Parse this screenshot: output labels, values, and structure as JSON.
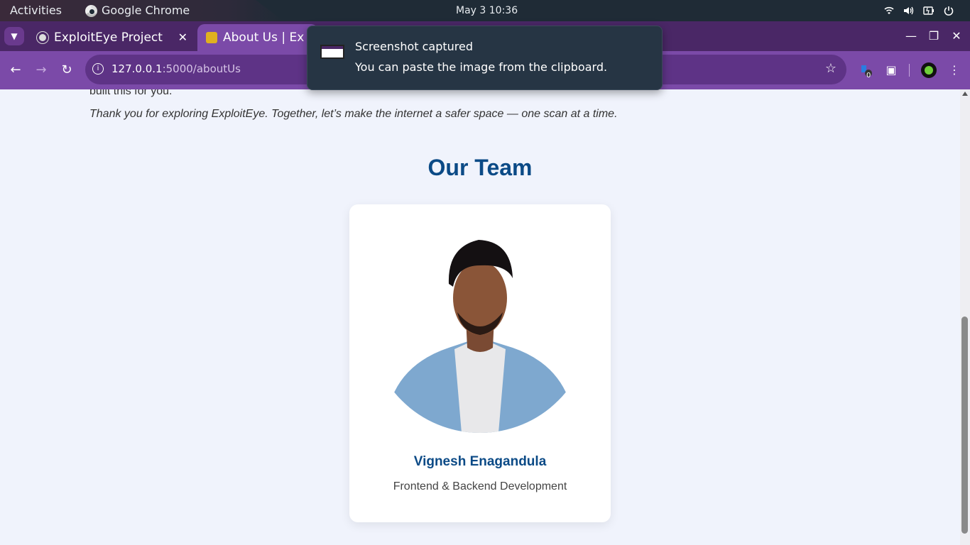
{
  "system_bar": {
    "activities": "Activities",
    "app_name": "Google Chrome",
    "clock": "May 3  10:36"
  },
  "tabs": [
    {
      "title": "ExploitEye Project",
      "active": false
    },
    {
      "title": "About Us | Ex",
      "active": true
    }
  ],
  "toolbar": {
    "url_host": "127.0.0.1",
    "url_rest": ":5000/aboutUs",
    "extension_badge": "0"
  },
  "notification": {
    "title": "Screenshot captured",
    "body": "You can paste the image from the clipboard."
  },
  "page": {
    "cut_text": "built this for you.",
    "thanks_text": "Thank you for exploring ExploitEye. Together, let’s make the internet a safer space — one scan at a time.",
    "team_heading": "Our Team",
    "members": [
      {
        "name": "Vignesh Enagandula",
        "role": "Frontend & Backend Development"
      }
    ]
  },
  "colors": {
    "heading": "#0b4a86",
    "chrome_frame": "#4a2766",
    "chrome_toolbar": "#7b4aa8",
    "page_bg": "#f0f3fc"
  },
  "icons": {
    "tray": [
      "wifi-icon",
      "volume-icon",
      "battery-icon",
      "power-icon"
    ],
    "toolbar": [
      "back-icon",
      "forward-icon",
      "reload-icon",
      "site-info-icon",
      "star-icon",
      "extension-icon",
      "puzzle-icon",
      "profile-icon",
      "menu-icon"
    ]
  }
}
